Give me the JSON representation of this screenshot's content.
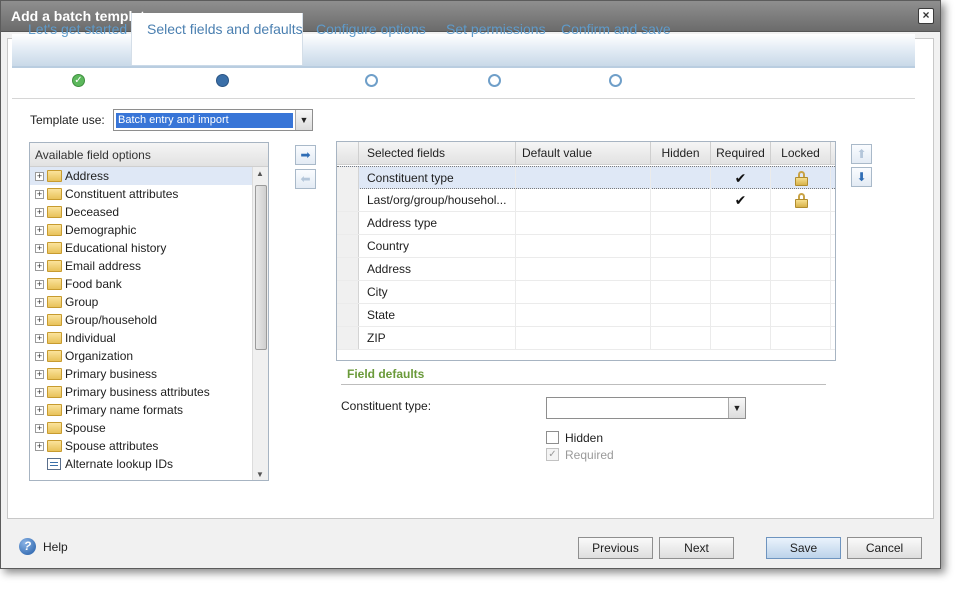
{
  "window": {
    "title": "Add a batch template"
  },
  "wizard": {
    "steps": [
      {
        "label": "Let's get started",
        "state": "done"
      },
      {
        "label": "Select fields and defaults",
        "state": "current"
      },
      {
        "label": "Configure options",
        "state": "open"
      },
      {
        "label": "Set permissions",
        "state": "open"
      },
      {
        "label": "Confirm and save",
        "state": "open"
      }
    ],
    "done_mark": "✓"
  },
  "template_use": {
    "label": "Template use:",
    "value": "Batch entry and import"
  },
  "available_fields": {
    "header": "Available field options",
    "items": [
      {
        "label": "Address",
        "kind": "folder"
      },
      {
        "label": "Constituent attributes",
        "kind": "folder"
      },
      {
        "label": "Deceased",
        "kind": "folder"
      },
      {
        "label": "Demographic",
        "kind": "folder"
      },
      {
        "label": "Educational history",
        "kind": "folder"
      },
      {
        "label": "Email address",
        "kind": "folder"
      },
      {
        "label": "Food bank",
        "kind": "folder"
      },
      {
        "label": "Group",
        "kind": "folder"
      },
      {
        "label": "Group/household",
        "kind": "folder"
      },
      {
        "label": "Individual",
        "kind": "folder"
      },
      {
        "label": "Organization",
        "kind": "folder"
      },
      {
        "label": "Primary business",
        "kind": "folder"
      },
      {
        "label": "Primary business attributes",
        "kind": "folder"
      },
      {
        "label": "Primary name formats",
        "kind": "folder"
      },
      {
        "label": "Spouse",
        "kind": "folder"
      },
      {
        "label": "Spouse attributes",
        "kind": "folder"
      },
      {
        "label": "Alternate lookup IDs",
        "kind": "field"
      }
    ]
  },
  "grid": {
    "columns": [
      "Selected fields",
      "Default value",
      "Hidden",
      "Required",
      "Locked"
    ],
    "rows": [
      {
        "field": "Constituent type",
        "default_value": "",
        "hidden": false,
        "required": true,
        "locked": true
      },
      {
        "field": "Last/org/group/househol...",
        "default_value": "",
        "hidden": false,
        "required": true,
        "locked": true
      },
      {
        "field": "Address type",
        "default_value": "",
        "hidden": false,
        "required": false,
        "locked": false
      },
      {
        "field": "Country",
        "default_value": "",
        "hidden": false,
        "required": false,
        "locked": false
      },
      {
        "field": "Address",
        "default_value": "",
        "hidden": false,
        "required": false,
        "locked": false
      },
      {
        "field": "City",
        "default_value": "",
        "hidden": false,
        "required": false,
        "locked": false
      },
      {
        "field": "State",
        "default_value": "",
        "hidden": false,
        "required": false,
        "locked": false
      },
      {
        "field": "ZIP",
        "default_value": "",
        "hidden": false,
        "required": false,
        "locked": false
      }
    ],
    "check_mark": "✔"
  },
  "field_defaults": {
    "heading": "Field defaults",
    "constituent_type_label": "Constituent type:",
    "constituent_type_value": "",
    "hidden_label": "Hidden",
    "required_label": "Required",
    "required_mark": "✓"
  },
  "footer": {
    "help_label": "Help",
    "previous_label": "Previous",
    "next_label": "Next",
    "save_label": "Save",
    "cancel_label": "Cancel"
  }
}
